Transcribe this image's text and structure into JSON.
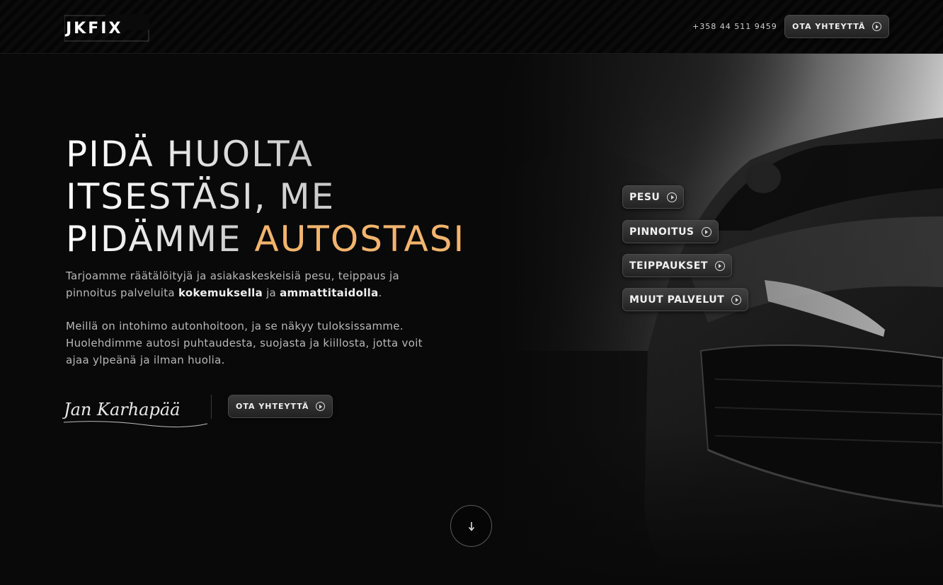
{
  "header": {
    "logo_text": "JKFIX",
    "phone": "+358 44 511 9459",
    "contact_label": "OTA YHTEYTTÄ"
  },
  "hero": {
    "headline_line1": "PIDÄ HUOLTA",
    "headline_line2": "ITSESTÄSI, ME",
    "headline_line3_plain": "PIDÄMME ",
    "headline_line3_accent": "AUTOSTASI",
    "para1_text_a": "Tarjoamme räätälöityjä ja asiakaskeskeisiä pesu, teippaus ja pinnoitus palveluita ",
    "para1_strong_a": "kokemuksella",
    "para1_text_b": " ja ",
    "para1_strong_b": "ammattitaidolla",
    "para1_text_c": ".",
    "para2": "Meillä on intohimo autonhoitoon, ja se näkyy tuloksissamme. Huolehdimme autosi puhtaudesta, suojasta ja kiillosta, jotta voit ajaa ylpeänä ja ilman huolia.",
    "signature_text": "Jan Karhapää",
    "cta_label": "OTA YHTEYTTÄ"
  },
  "services": [
    {
      "label": "PESU"
    },
    {
      "label": "PINNOITUS"
    },
    {
      "label": "TEIPPAUKSET"
    },
    {
      "label": "MUUT PALVELUT"
    }
  ],
  "colors": {
    "accent": "#f2b46e",
    "background": "#0a0a0a"
  },
  "icons": {
    "play": "play-circle-icon",
    "scroll": "arrow-down-icon"
  }
}
